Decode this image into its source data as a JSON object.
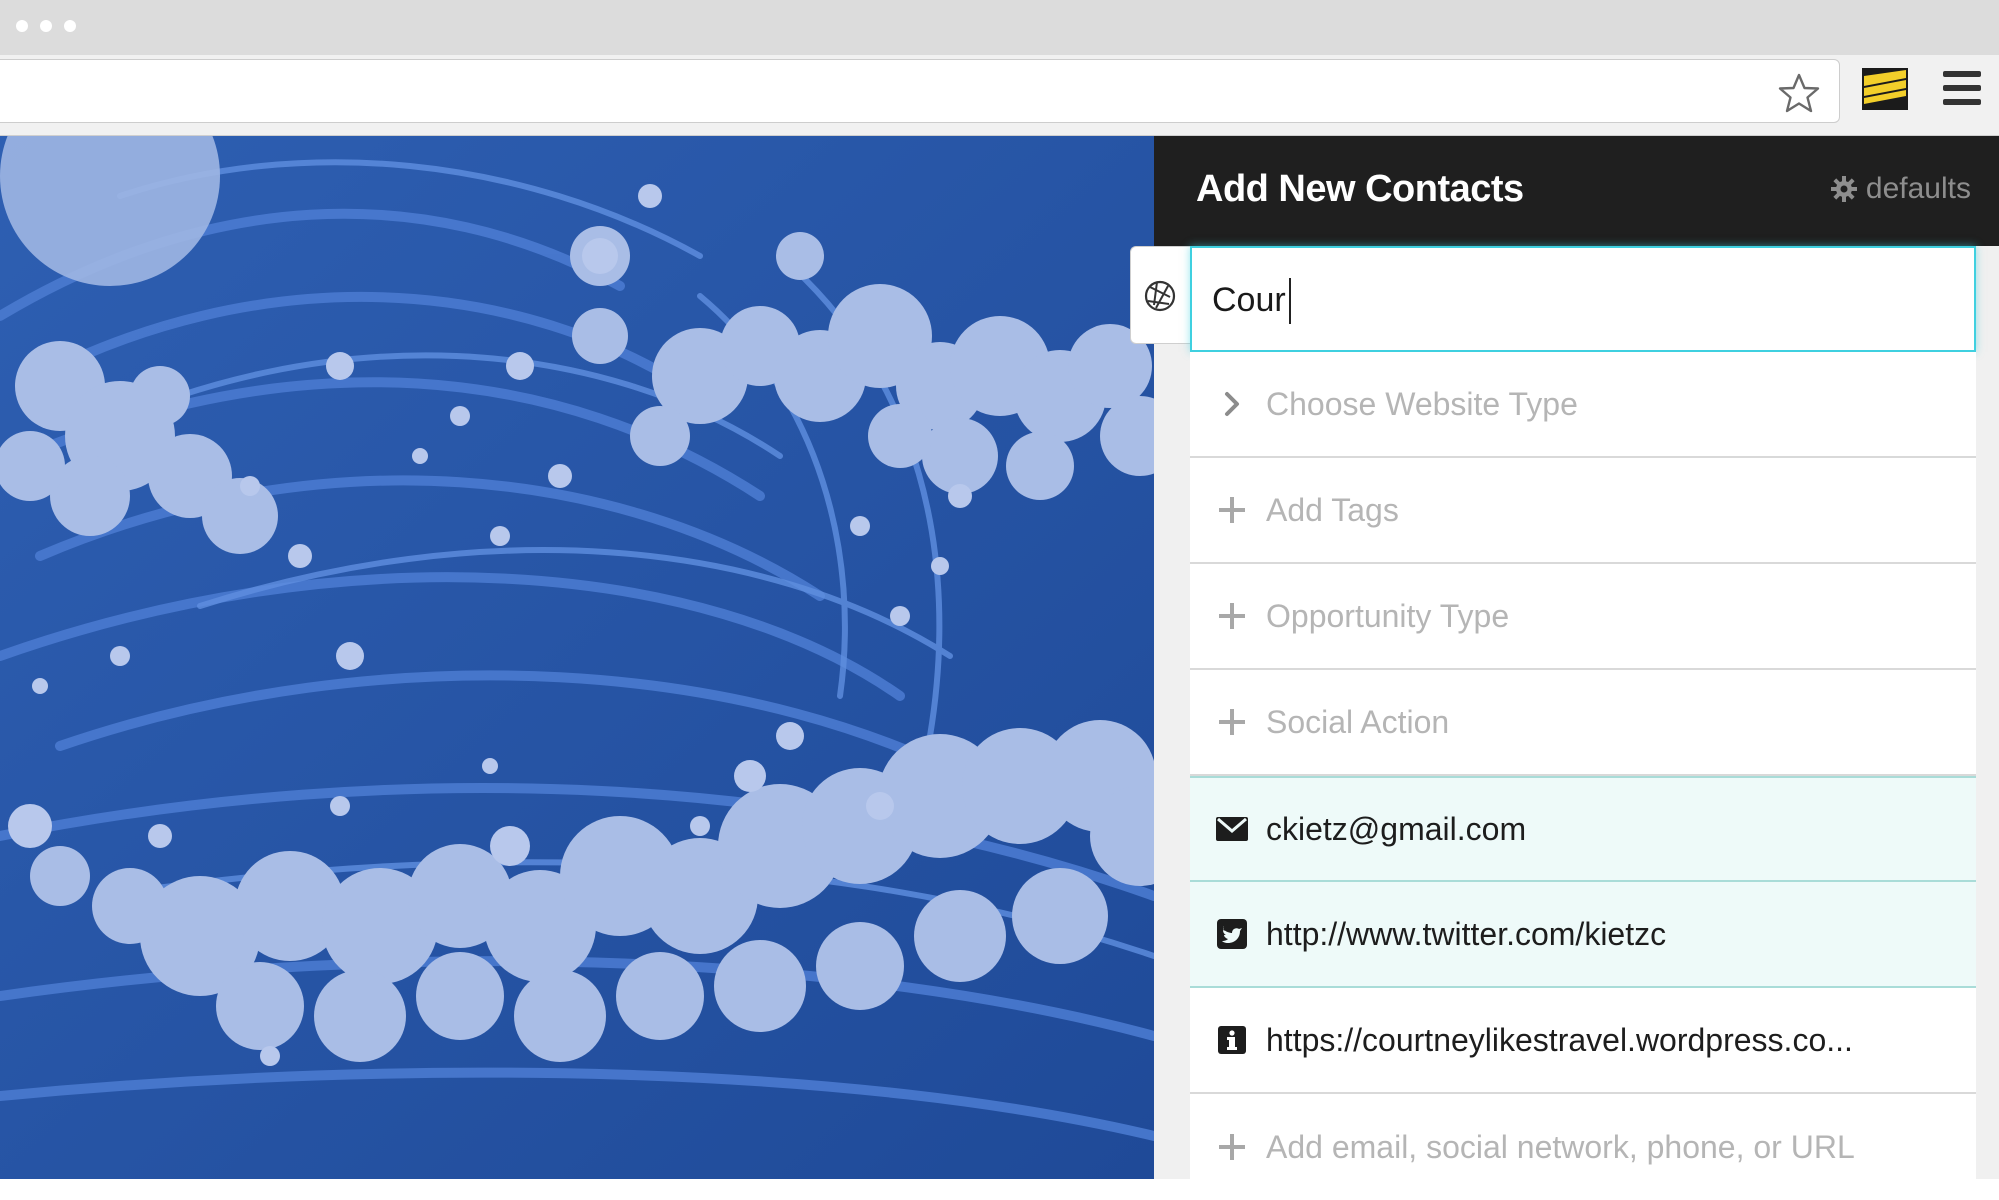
{
  "toolbar": {
    "bookmark_icon": "star-outline-icon",
    "extension_icon": "flag-extension-icon",
    "menu_icon": "hamburger-menu-icon"
  },
  "panel": {
    "title": "Add New Contacts",
    "defaults_label": "defaults",
    "side_tab_icon": "aperture-icon",
    "name_input_value": "Cour",
    "rows": [
      {
        "icon": "chevron-right-icon",
        "label": "Choose Website Type"
      },
      {
        "icon": "plus-icon",
        "label": "Add Tags"
      },
      {
        "icon": "plus-icon",
        "label": "Opportunity Type"
      },
      {
        "icon": "plus-icon",
        "label": "Social Action"
      },
      {
        "icon": "envelope-icon",
        "label": "ckietz@gmail.com"
      },
      {
        "icon": "twitter-icon",
        "label": "http://www.twitter.com/kietzc"
      },
      {
        "icon": "info-icon",
        "label": "https://courtneylikestravel.wordpress.co..."
      },
      {
        "icon": "plus-icon",
        "label": "Add email, social network, phone, or URL"
      }
    ]
  },
  "colors": {
    "header_bg": "#1f1f1f",
    "focus_accent": "#3fd0e0",
    "filled_row_bg": "#eefaf9",
    "wave_dark": "#2f5fae",
    "foam": "#a9bde6"
  }
}
